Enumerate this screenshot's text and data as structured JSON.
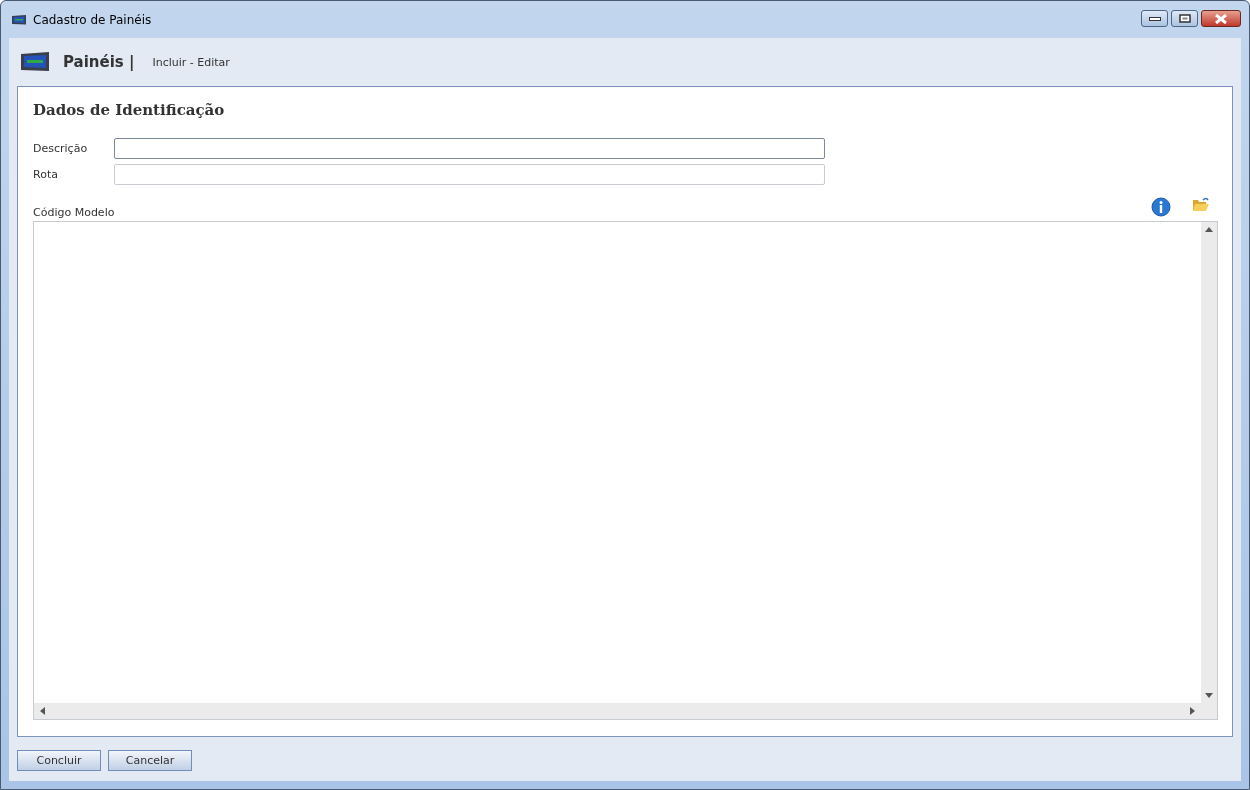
{
  "window": {
    "title": "Cadastro de Painéis"
  },
  "header": {
    "title": "Painéis |",
    "subtitle": "Incluir - Editar"
  },
  "section": {
    "title": "Dados de Identificação"
  },
  "fields": [
    {
      "label": "Descrição",
      "focused": true
    },
    {
      "label": "Rota",
      "focused": false
    }
  ],
  "code_editor": {
    "label": "Código Modelo"
  },
  "buttons": [
    "Concluir",
    "Cancelar"
  ]
}
